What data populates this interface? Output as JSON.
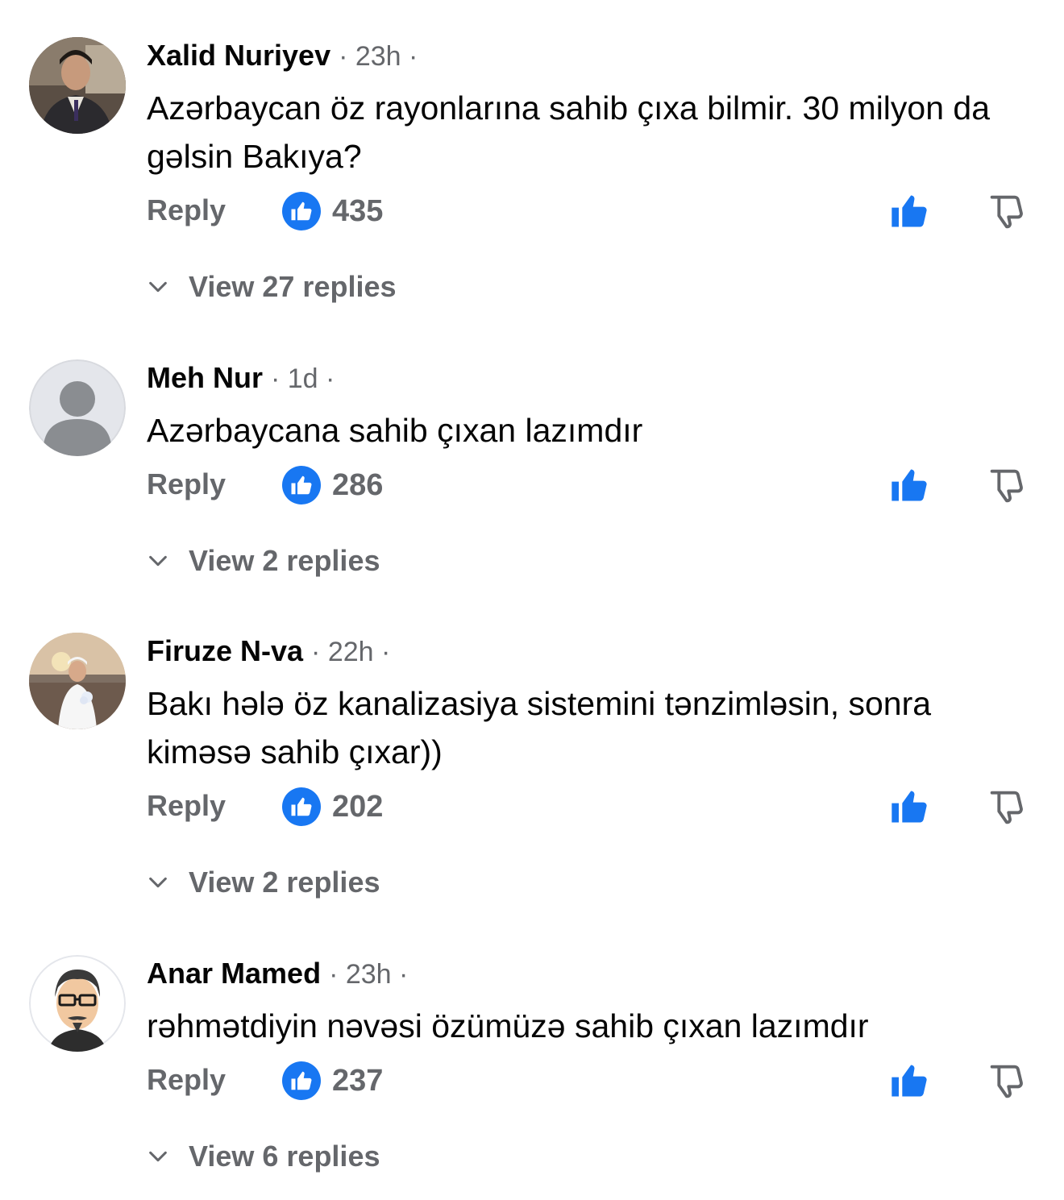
{
  "colors": {
    "accent": "#1877f2",
    "secondary_text": "#65676b",
    "primary_text": "#050505"
  },
  "comments": [
    {
      "author": "Xalid Nuriyev",
      "meta": "· 23h ·",
      "text": "Azərbaycan öz rayonlarına sahib çıxa bilmir. 30 milyon da gəlsin Bakıya?",
      "reply_label": "Reply",
      "likes": "435",
      "view_replies": "View 27 replies"
    },
    {
      "author": "Meh Nur",
      "meta": "· 1d ·",
      "text": "Azərbaycana sahib çıxan lazımdır",
      "reply_label": "Reply",
      "likes": "286",
      "view_replies": "View 2 replies"
    },
    {
      "author": "Firuze N-va",
      "meta": "· 22h ·",
      "text": "Bakı hələ öz kanalizasiya sistemini tənzimləsin, sonra kiməsə sahib çıxar))",
      "reply_label": "Reply",
      "likes": "202",
      "view_replies": "View 2 replies"
    },
    {
      "author": "Anar Mamed",
      "meta": "· 23h ·",
      "text": "rəhmətdiyin nəvəsi özümüzə sahib çıxan lazımdır",
      "reply_label": "Reply",
      "likes": "237",
      "view_replies": "View 6 replies"
    }
  ]
}
